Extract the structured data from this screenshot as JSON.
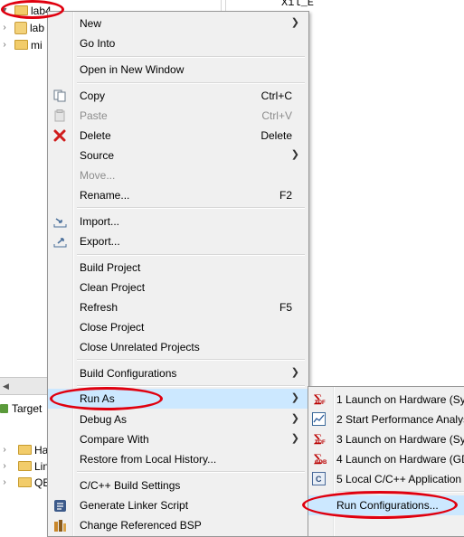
{
  "explorer": {
    "items": [
      {
        "label": "lab4"
      },
      {
        "label": "lab"
      },
      {
        "label": "mi"
      }
    ],
    "editor_snippet": "Xil_E"
  },
  "lower_panel": {
    "target_tab": "Target",
    "items": [
      {
        "label": "Ha"
      },
      {
        "label": "Lin"
      },
      {
        "label": "QE"
      }
    ]
  },
  "context_menu": {
    "items": [
      {
        "label": "New",
        "shortcut": "",
        "submenu": true
      },
      {
        "label": "Go Into",
        "shortcut": ""
      },
      {
        "label": "Open in New Window",
        "shortcut": ""
      },
      {
        "label": "Copy",
        "shortcut": "Ctrl+C"
      },
      {
        "label": "Paste",
        "shortcut": "Ctrl+V"
      },
      {
        "label": "Delete",
        "shortcut": "Delete"
      },
      {
        "label": "Source",
        "shortcut": "",
        "submenu": true
      },
      {
        "label": "Move...",
        "shortcut": ""
      },
      {
        "label": "Rename...",
        "shortcut": "F2"
      },
      {
        "label": "Import...",
        "shortcut": ""
      },
      {
        "label": "Export...",
        "shortcut": ""
      },
      {
        "label": "Build Project",
        "shortcut": ""
      },
      {
        "label": "Clean Project",
        "shortcut": ""
      },
      {
        "label": "Refresh",
        "shortcut": "F5"
      },
      {
        "label": "Close Project",
        "shortcut": ""
      },
      {
        "label": "Close Unrelated Projects",
        "shortcut": ""
      },
      {
        "label": "Build Configurations",
        "shortcut": "",
        "submenu": true
      },
      {
        "label": "Run As",
        "shortcut": "",
        "submenu": true
      },
      {
        "label": "Debug As",
        "shortcut": "",
        "submenu": true
      },
      {
        "label": "Compare With",
        "shortcut": "",
        "submenu": true
      },
      {
        "label": "Restore from Local History...",
        "shortcut": ""
      },
      {
        "label": "C/C++ Build Settings",
        "shortcut": ""
      },
      {
        "label": "Generate Linker Script",
        "shortcut": ""
      },
      {
        "label": "Change Referenced BSP",
        "shortcut": ""
      }
    ]
  },
  "run_as_submenu": {
    "items": [
      {
        "label": "1 Launch on Hardware (Sys",
        "icon": "TCF"
      },
      {
        "label": "2 Start Performance Analys",
        "icon": "chart"
      },
      {
        "label": "3 Launch on Hardware (Sys",
        "icon": "TCF"
      },
      {
        "label": "4 Launch on Hardware (GD",
        "icon": "GDB"
      },
      {
        "label": "5 Local C/C++ Application",
        "icon": "C"
      },
      {
        "label": "Run Configurations...",
        "icon": ""
      }
    ]
  },
  "colors": {
    "highlight": "#cce8ff",
    "annotation": "#e0000f"
  }
}
